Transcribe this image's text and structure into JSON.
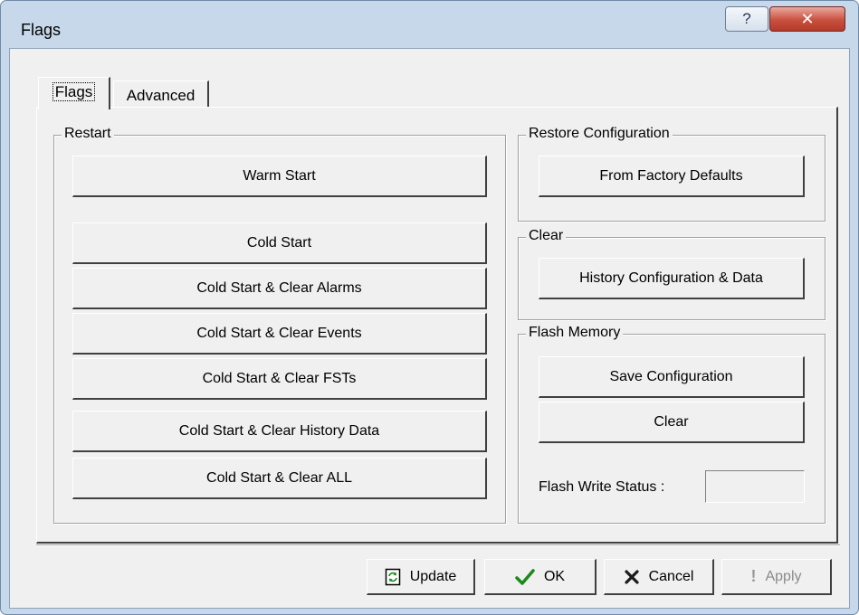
{
  "window": {
    "title": "Flags"
  },
  "tabs": [
    {
      "label": "Flags"
    },
    {
      "label": "Advanced"
    }
  ],
  "restart": {
    "title": "Restart",
    "buttons": [
      {
        "label": "Warm Start"
      },
      {
        "label": "Cold Start"
      },
      {
        "label": "Cold Start & Clear Alarms"
      },
      {
        "label": "Cold Start & Clear Events"
      },
      {
        "label": "Cold Start & Clear FSTs"
      },
      {
        "label": "Cold Start & Clear History Data"
      },
      {
        "label": "Cold Start & Clear ALL"
      }
    ]
  },
  "restore": {
    "title": "Restore Configuration",
    "button": "From Factory Defaults"
  },
  "clear_group": {
    "title": "Clear",
    "button": "History Configuration & Data"
  },
  "flash": {
    "title": "Flash Memory",
    "save_button": "Save Configuration",
    "clear_button": "Clear",
    "status_label": "Flash Write Status :",
    "status_value": ""
  },
  "footer": {
    "update": "Update",
    "ok": "OK",
    "cancel": "Cancel",
    "apply": "Apply"
  },
  "icons": {
    "help": "help-icon",
    "close": "close-icon",
    "update": "update-icon",
    "ok": "checkmark-icon",
    "cancel": "cross-icon",
    "apply": "exclamation-icon"
  },
  "colors": {
    "ok_check": "#1a8a1a",
    "cancel_x": "#1a1a1a",
    "close_button": "#c9503f"
  }
}
